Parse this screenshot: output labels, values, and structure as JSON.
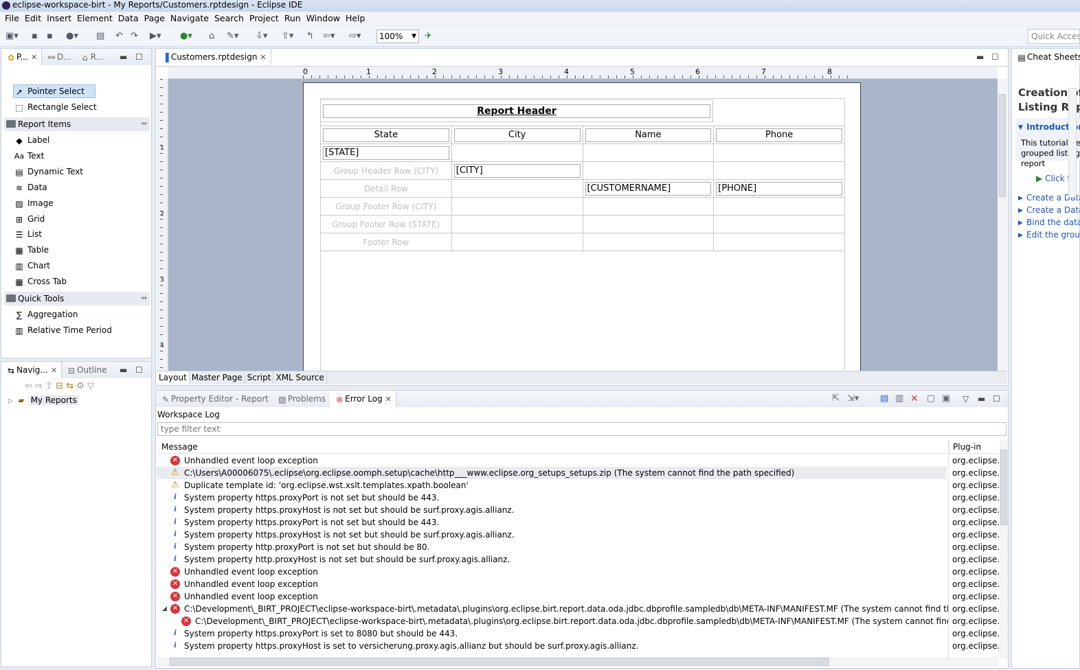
{
  "window": {
    "title": "eclipse-workspace-birt - My Reports/Customers.rptdesign - Eclipse IDE"
  },
  "menu": [
    "File",
    "Edit",
    "Insert",
    "Element",
    "Data",
    "Page",
    "Navigate",
    "Search",
    "Project",
    "Run",
    "Window",
    "Help"
  ],
  "toolbar": {
    "zoom": "100%",
    "quick_access": "Quick Access"
  },
  "palette_panel": {
    "tabs": [
      {
        "label": "P..."
      },
      {
        "label": "D..."
      },
      {
        "label": "R..."
      }
    ],
    "tools": [
      {
        "label": "Pointer Select"
      },
      {
        "label": "Rectangle Select"
      }
    ],
    "report_items_title": "Report Items",
    "report_items": [
      {
        "label": "Label",
        "icon": "label-tag-icon"
      },
      {
        "label": "Text",
        "icon": "text-aa-icon"
      },
      {
        "label": "Dynamic Text",
        "icon": "dynamic-text-icon"
      },
      {
        "label": "Data",
        "icon": "database-icon"
      },
      {
        "label": "Image",
        "icon": "image-icon"
      },
      {
        "label": "Grid",
        "icon": "grid-icon"
      },
      {
        "label": "List",
        "icon": "list-icon"
      },
      {
        "label": "Table",
        "icon": "table-icon"
      },
      {
        "label": "Chart",
        "icon": "chart-icon"
      },
      {
        "label": "Cross Tab",
        "icon": "crosstab-icon"
      }
    ],
    "quick_tools_title": "Quick Tools",
    "quick_tools": [
      {
        "label": "Aggregation",
        "icon": "sigma-icon"
      },
      {
        "label": "Relative Time Period",
        "icon": "time-period-icon"
      }
    ]
  },
  "navigator_panel": {
    "tabs": [
      {
        "label": "Navig..."
      },
      {
        "label": "Outline"
      }
    ],
    "tree": [
      {
        "label": "My Reports"
      }
    ]
  },
  "editor": {
    "tab": "Customers.rptdesign",
    "ruler_numbers": [
      "0",
      "1",
      "2",
      "3",
      "4",
      "5",
      "6",
      "7",
      "8"
    ],
    "vruler_numbers": [
      "1",
      "2",
      "3",
      "4"
    ],
    "report_header": "Report Header",
    "columns": [
      "State",
      "City",
      "Name",
      "Phone"
    ],
    "state_field": "[STATE]",
    "city_field": "[CITY]",
    "name_field": "[CUSTOMERNAME]",
    "phone_field": "[PHONE]",
    "row_labels": {
      "group_header_city": "Group Header Row (CITY)",
      "detail": "Detail Row",
      "group_footer_city": "Group Footer Row (CITY)",
      "group_footer_state": "Group Footer Row (STATE)",
      "footer": "Footer Row"
    },
    "bottom_tabs": [
      "Layout",
      "Master Page",
      "Script",
      "XML Source"
    ]
  },
  "log_panel": {
    "tabs": [
      {
        "label": "Property Editor - Report"
      },
      {
        "label": "Problems"
      },
      {
        "label": "Error Log"
      }
    ],
    "section": "Workspace Log",
    "filter_placeholder": "type filter text",
    "col_message": "Message",
    "col_plugin": "Plug-in",
    "rows": [
      {
        "sev": "err",
        "message": "Unhandled event loop exception",
        "plugin": "org.eclipse.u"
      },
      {
        "sev": "warn",
        "message": "C:\\Users\\A00006075\\.eclipse\\org.eclipse.oomph.setup\\cache\\http___www.eclipse.org_setups_setups.zip (The system cannot find the path specified)",
        "plugin": "org.eclipse.o"
      },
      {
        "sev": "warn",
        "message": "Duplicate template id: 'org.eclipse.wst.xslt.templates.xpath.boolean'",
        "plugin": "org.eclipse.j"
      },
      {
        "sev": "info",
        "message": "System property https.proxyPort is not set but should be 443.",
        "plugin": "org.eclipse.c"
      },
      {
        "sev": "info",
        "message": "System property https.proxyHost is not set but should be surf.proxy.agis.allianz.",
        "plugin": "org.eclipse.c"
      },
      {
        "sev": "info",
        "message": "System property https.proxyPort is not set but should be 443.",
        "plugin": "org.eclipse.c"
      },
      {
        "sev": "info",
        "message": "System property https.proxyHost is not set but should be surf.proxy.agis.allianz.",
        "plugin": "org.eclipse.c"
      },
      {
        "sev": "info",
        "message": "System property http.proxyPort is not set but should be 80.",
        "plugin": "org.eclipse.c"
      },
      {
        "sev": "info",
        "message": "System property http.proxyHost is not set but should be surf.proxy.agis.allianz.",
        "plugin": "org.eclipse.c"
      },
      {
        "sev": "err",
        "message": "Unhandled event loop exception",
        "plugin": "org.eclipse.u"
      },
      {
        "sev": "err",
        "message": "Unhandled event loop exception",
        "plugin": "org.eclipse.u"
      },
      {
        "sev": "err",
        "message": "Unhandled event loop exception",
        "plugin": "org.eclipse.u"
      },
      {
        "sev": "err",
        "message": "C:\\Development\\_BIRT_PROJECT\\eclipse-workspace-birt\\.metadata\\.plugins\\org.eclipse.birt.report.data.oda.jdbc.dbprofile.sampledb\\db\\META-INF\\MANIFEST.MF (The system cannot find the path specified)",
        "plugin": "org.eclipse.c"
      },
      {
        "sev": "err",
        "message": "C:\\Development\\_BIRT_PROJECT\\eclipse-workspace-birt\\.metadata\\.plugins\\org.eclipse.birt.report.data.oda.jdbc.dbprofile.sampledb\\db\\META-INF\\MANIFEST.MF (The system cannot find the path specified)",
        "plugin": "org.eclipse.b"
      },
      {
        "sev": "info",
        "message": "System property https.proxyPort is set to 8080 but should be 443.",
        "plugin": "org.eclipse.c"
      },
      {
        "sev": "info",
        "message": "System property https.proxyHost is set to versicherung.proxy.agis.allianz but should be surf.proxy.agis.allianz.",
        "plugin": "org.eclipse.c"
      }
    ]
  },
  "cheat_sheets": {
    "tab": "Cheat Sheets",
    "title1": "Creation of",
    "title2": "Listing Repo",
    "intro": "Introduction",
    "body1": "This tutorial hel",
    "body2": "grouped listing",
    "body3": "report",
    "click": "Click to",
    "links": [
      "Create a DataS",
      "Create a DataS",
      "Bind the data",
      "Edit the group"
    ]
  }
}
